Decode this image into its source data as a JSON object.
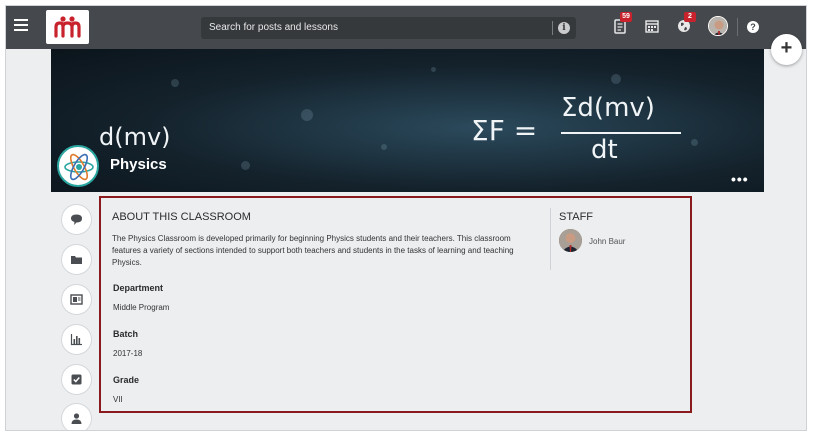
{
  "header": {
    "search_placeholder": "Search for posts and lessons",
    "posts_badge": "59",
    "notifications_badge": "2"
  },
  "banner": {
    "class_name": "Physics",
    "formula_left": "d(mv)",
    "formula_main_lhs": "ΣF =",
    "formula_main_num": "Σd(mv)",
    "formula_main_den": "dt"
  },
  "about": {
    "title": "ABOUT THIS CLASSROOM",
    "description": "The Physics Classroom is developed primarily for beginning Physics students and their teachers. This classroom features a variety of sections intended to support both teachers and students in the tasks of learning and teaching Physics.",
    "fields": [
      {
        "label": "Department",
        "value": "Middle Program"
      },
      {
        "label": "Batch",
        "value": "2017-18"
      },
      {
        "label": "Grade",
        "value": "VII"
      }
    ]
  },
  "staff": {
    "title": "STAFF",
    "members": [
      {
        "name": "John Baur"
      }
    ]
  },
  "colors": {
    "topbar": "#45484c",
    "accent_border": "#8b1a1e",
    "badge": "#c8232c",
    "brand_red": "#c8232c"
  },
  "icons": {
    "menu": "hamburger-icon",
    "info": "info-icon",
    "posts": "document-icon",
    "calendar": "calendar-icon",
    "globe": "globe-icon",
    "help": "help-icon",
    "add": "plus-icon",
    "more": "ellipsis-icon",
    "side_nav": [
      "chat-icon",
      "folder-icon",
      "slides-icon",
      "bar-chart-icon",
      "checkbox-icon",
      "user-icon"
    ]
  }
}
